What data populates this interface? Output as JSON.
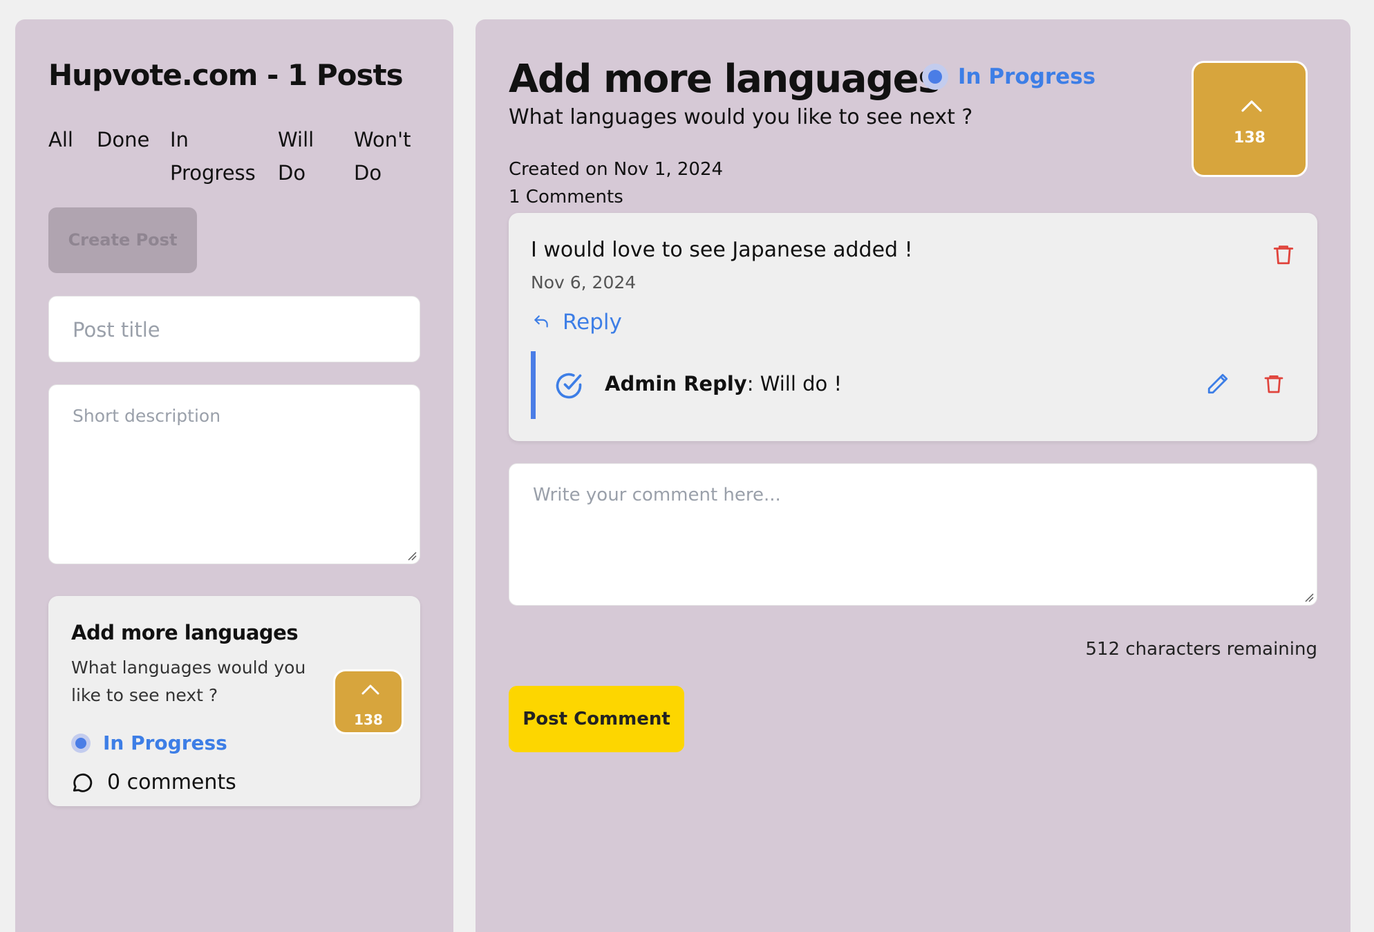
{
  "sidebar": {
    "site_title": "Hupvote.com - 1 Posts",
    "filters": [
      "All",
      "Done",
      "In Progress",
      "Will Do",
      "Won't Do"
    ],
    "create_post_label": "Create Post",
    "title_placeholder": "Post title",
    "description_placeholder": "Short description",
    "post_card": {
      "title": "Add more languages",
      "description": "What languages would you like to see next ?",
      "status": "In Progress",
      "vote_count": "138",
      "comments_label": "0 comments"
    }
  },
  "post_detail": {
    "title": "Add more languages",
    "status": "In Progress",
    "subtitle": "What languages would you like to see next ?",
    "created": "Created on Nov 1, 2024",
    "comments_count": "1 Comments",
    "vote_count": "138",
    "comment": {
      "text": "I would love to see Japanese added !",
      "date": "Nov 6, 2024",
      "reply_label": "Reply",
      "admin_reply_label": "Admin Reply",
      "admin_reply_text": ": Will do !"
    },
    "comment_placeholder": "Write your comment here...",
    "chars_remaining": "512 characters remaining",
    "post_comment_label": "Post Comment"
  },
  "colors": {
    "panel_bg": "#d6c9d6",
    "accent_blue": "#3d7ee6",
    "vote_gold": "#d7a53d",
    "post_comment_yellow": "#fdd600",
    "delete_red": "#e0443c"
  },
  "icons": [
    "chevron-up-icon",
    "comment-bubble-icon",
    "reply-arrow-icon",
    "trash-icon",
    "check-circle-icon",
    "pencil-icon"
  ]
}
